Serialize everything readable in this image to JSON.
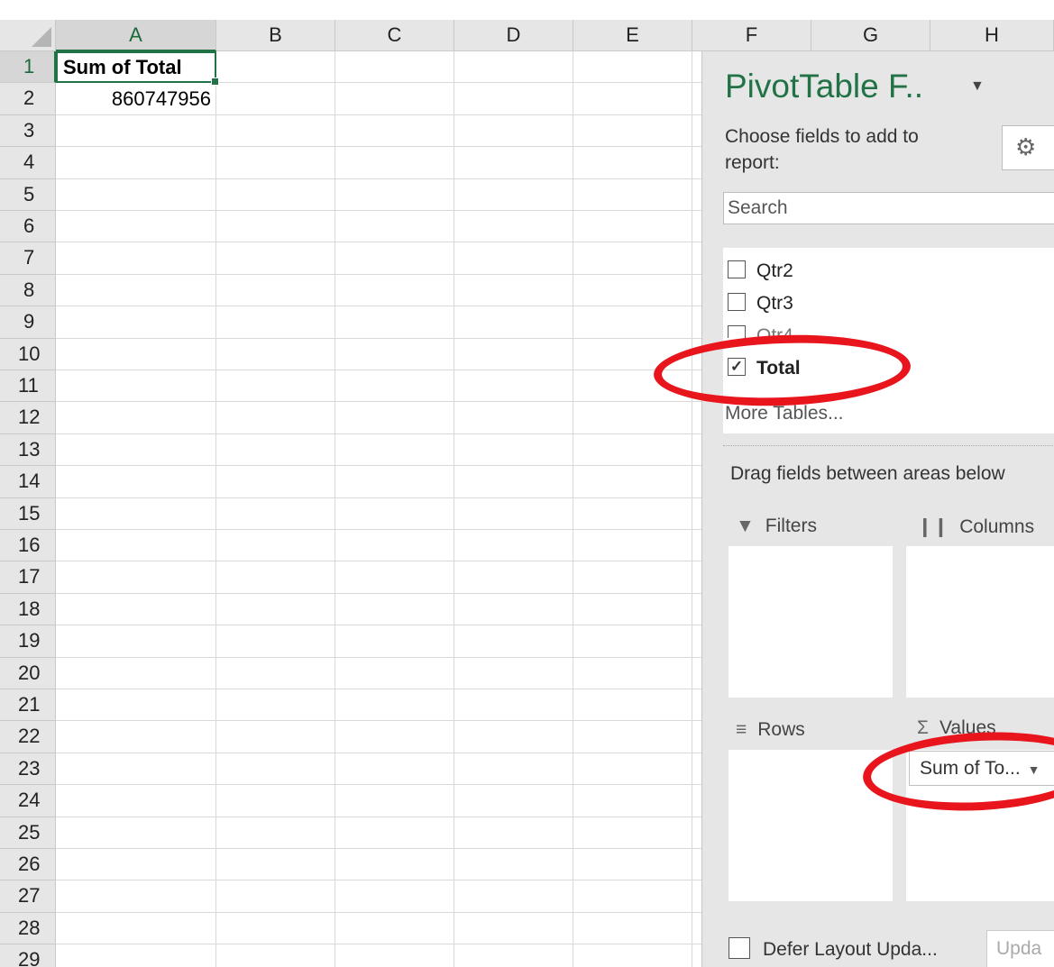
{
  "spreadsheet": {
    "columns": [
      "A",
      "B",
      "C",
      "D",
      "E",
      "F",
      "G",
      "H"
    ],
    "rows": [
      "1",
      "2",
      "3",
      "4",
      "5",
      "6",
      "7",
      "8",
      "9",
      "10",
      "11",
      "12",
      "13",
      "14",
      "15",
      "16",
      "17",
      "18",
      "19",
      "20",
      "21",
      "22",
      "23",
      "24",
      "25",
      "26",
      "27",
      "28",
      "29"
    ],
    "cells": {
      "A1": "Sum of Total",
      "A2": "860747956"
    }
  },
  "pivot_pane": {
    "title": "PivotTable F..",
    "choose_label": "Choose fields to add to report:",
    "search_placeholder": "Search",
    "fields": [
      {
        "label": "Qtr2",
        "checked": false
      },
      {
        "label": "Qtr3",
        "checked": false
      },
      {
        "label": "Qtr4",
        "checked": false
      },
      {
        "label": "Total",
        "checked": true
      }
    ],
    "more_tables": "More Tables...",
    "drag_hint": "Drag fields between areas below",
    "areas": {
      "filters": "Filters",
      "columns": "Columns",
      "rows": "Rows",
      "values": "Values"
    },
    "value_item": "Sum of To...",
    "defer_label": "Defer Layout Upda...",
    "update_button": "Upda"
  },
  "colors": {
    "accent": "#217346",
    "annotation": "#e8151c"
  }
}
